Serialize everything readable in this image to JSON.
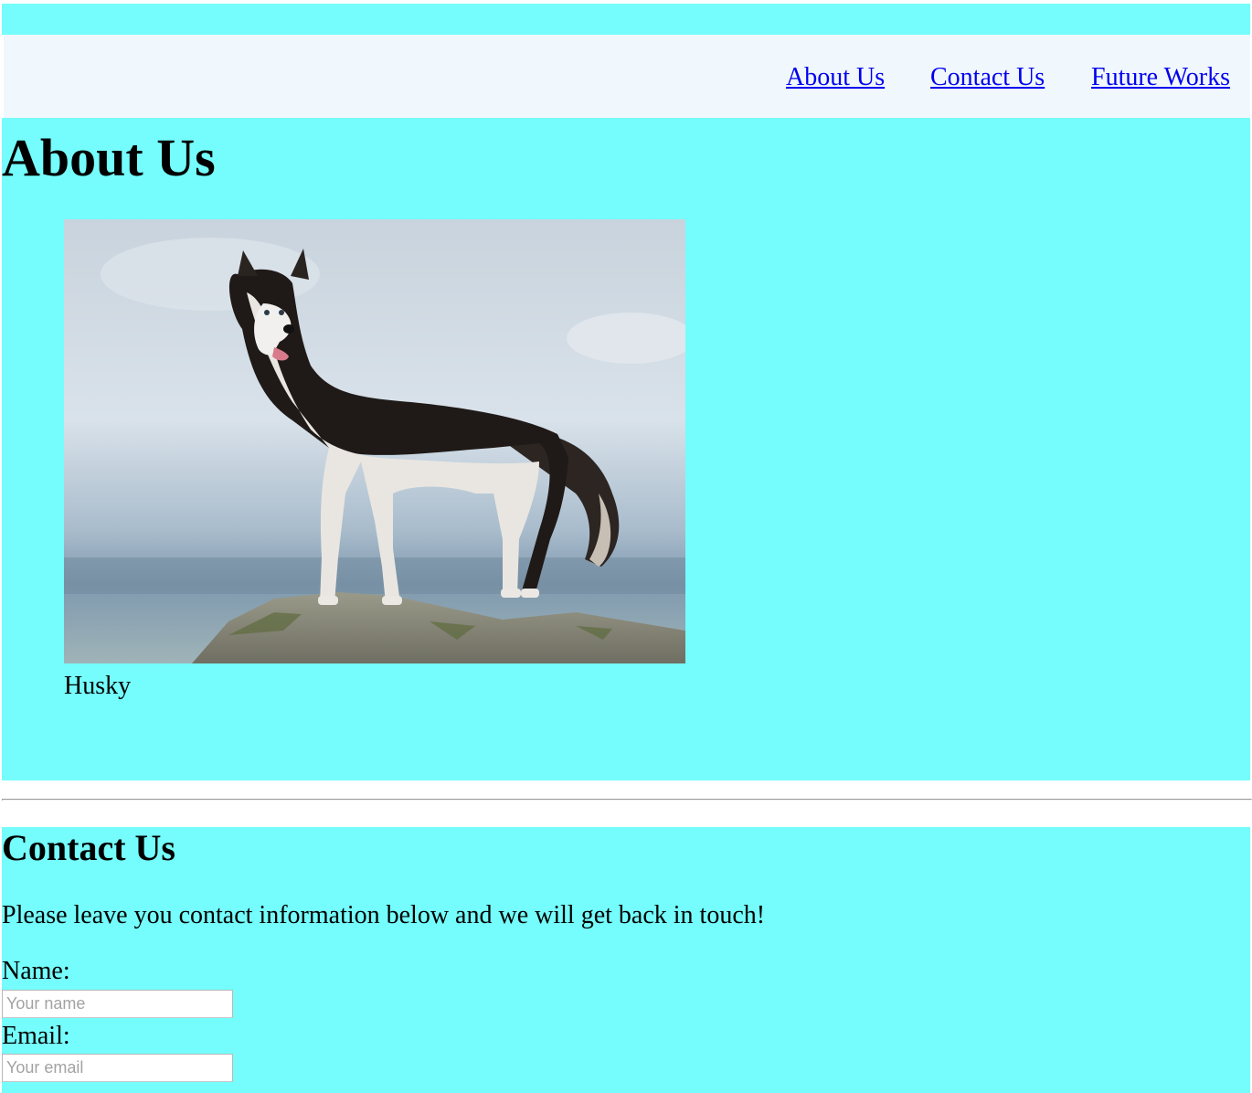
{
  "nav": {
    "links": [
      {
        "label": "About Us"
      },
      {
        "label": "Contact Us"
      },
      {
        "label": "Future Works"
      }
    ]
  },
  "about": {
    "title": "About Us",
    "image_caption": "Husky"
  },
  "contact": {
    "title": "Contact Us",
    "description": "Please leave you contact information below and we will get back in touch!",
    "name_label": "Name:",
    "name_placeholder": "Your name",
    "email_label": "Email:",
    "email_placeholder": "Your email"
  },
  "colors": {
    "section_bg": "#74fdfc",
    "navbar_bg": "#f0f7fd",
    "link": "#0000ee"
  }
}
